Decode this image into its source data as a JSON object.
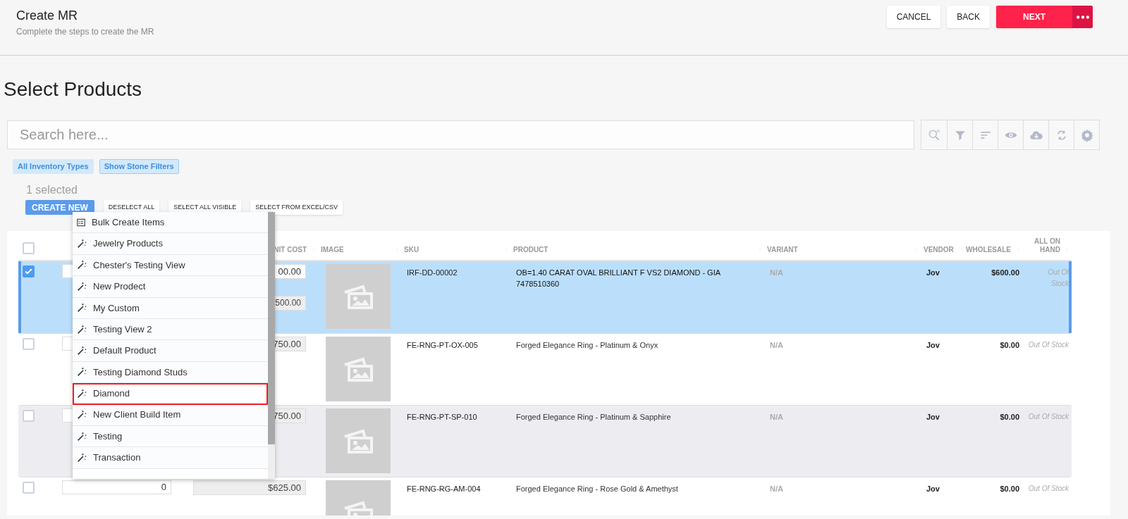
{
  "header": {
    "title": "Create MR",
    "subtitle": "Complete the steps to create the MR"
  },
  "actions": [
    {
      "label": "CANCEL",
      "kind": "plain"
    },
    {
      "label": "BACK",
      "kind": "plain"
    },
    {
      "label": "NEXT",
      "kind": "primary"
    }
  ],
  "page_title": "Select Products",
  "search": {
    "placeholder": "Search here..."
  },
  "filter_chips": [
    {
      "label": "All Inventory Types",
      "outlined": false
    },
    {
      "label": "Show Stone Filters",
      "outlined": true
    }
  ],
  "selection_count": "1 selected",
  "bulk_actions": [
    {
      "label": "CREATE NEW",
      "primary": true
    },
    {
      "label": "DESELECT ALL",
      "primary": false
    },
    {
      "label": "SELECT ALL VISIBLE",
      "primary": false
    },
    {
      "label": "SELECT FROM EXCEL/CSV",
      "primary": false
    }
  ],
  "table": {
    "all_selected": false,
    "columns": [
      "NIT COST",
      "IMAGE",
      "SKU",
      "PRODUCT",
      "VARIANT",
      "VENDOR",
      "WHOLESALE",
      "ALL ON HAND"
    ],
    "rows": [
      {
        "selected": true,
        "hovered": false,
        "unit_cost": "00.00",
        "total": "500.00",
        "sku": "IRF-DD-00002",
        "product": "OB=1.40 CARAT OVAL BRILLIANT F VS2 DIAMOND - GIA 7478510360",
        "variant": "N/A",
        "vendor": "Jov",
        "wholesale": "$600.00",
        "on_hand": "Out Of Stock"
      },
      {
        "selected": false,
        "hovered": false,
        "unit_cost": "750.00",
        "sku": "FE-RNG-PT-OX-005",
        "product": "Forged Elegance Ring - Platinum & Onyx",
        "variant": "N/A",
        "vendor": "Jov",
        "wholesale": "$0.00",
        "on_hand": "Out Of Stock"
      },
      {
        "selected": false,
        "hovered": true,
        "unit_cost": "750.00",
        "sku": "FE-RNG-PT-SP-010",
        "product": "Forged Elegance Ring - Platinum & Sapphire",
        "variant": "N/A",
        "vendor": "Jov",
        "wholesale": "$0.00",
        "on_hand": "Out Of Stock"
      },
      {
        "selected": false,
        "hovered": false,
        "quantity": "0",
        "unit_cost": "$625.00",
        "sku": "FE-RNG-RG-AM-004",
        "product": "Forged Elegance Ring - Rose Gold & Amethyst",
        "variant": "N/A",
        "vendor": "Jov",
        "wholesale": "$0.00",
        "on_hand": "Out Of Stock"
      }
    ]
  },
  "create_menu": {
    "items": [
      {
        "kind": "bulk",
        "label": "Bulk Create Items",
        "highlighted": false
      },
      {
        "kind": "view",
        "label": "Jewelry Products",
        "highlighted": false
      },
      {
        "kind": "view",
        "label": "Chester's Testing View",
        "highlighted": false
      },
      {
        "kind": "view",
        "label": "New Prodect",
        "highlighted": false
      },
      {
        "kind": "view",
        "label": "My Custom",
        "highlighted": false
      },
      {
        "kind": "view",
        "label": "Testing View 2",
        "highlighted": false
      },
      {
        "kind": "view",
        "label": "Default Product",
        "highlighted": false
      },
      {
        "kind": "view",
        "label": "Testing Diamond Studs",
        "highlighted": false
      },
      {
        "kind": "view",
        "label": "Diamond",
        "highlighted": true
      },
      {
        "kind": "view",
        "label": "New Client Build Item",
        "highlighted": false
      },
      {
        "kind": "view",
        "label": "Testing",
        "highlighted": false
      },
      {
        "kind": "view",
        "label": "Transaction",
        "highlighted": false
      }
    ]
  }
}
